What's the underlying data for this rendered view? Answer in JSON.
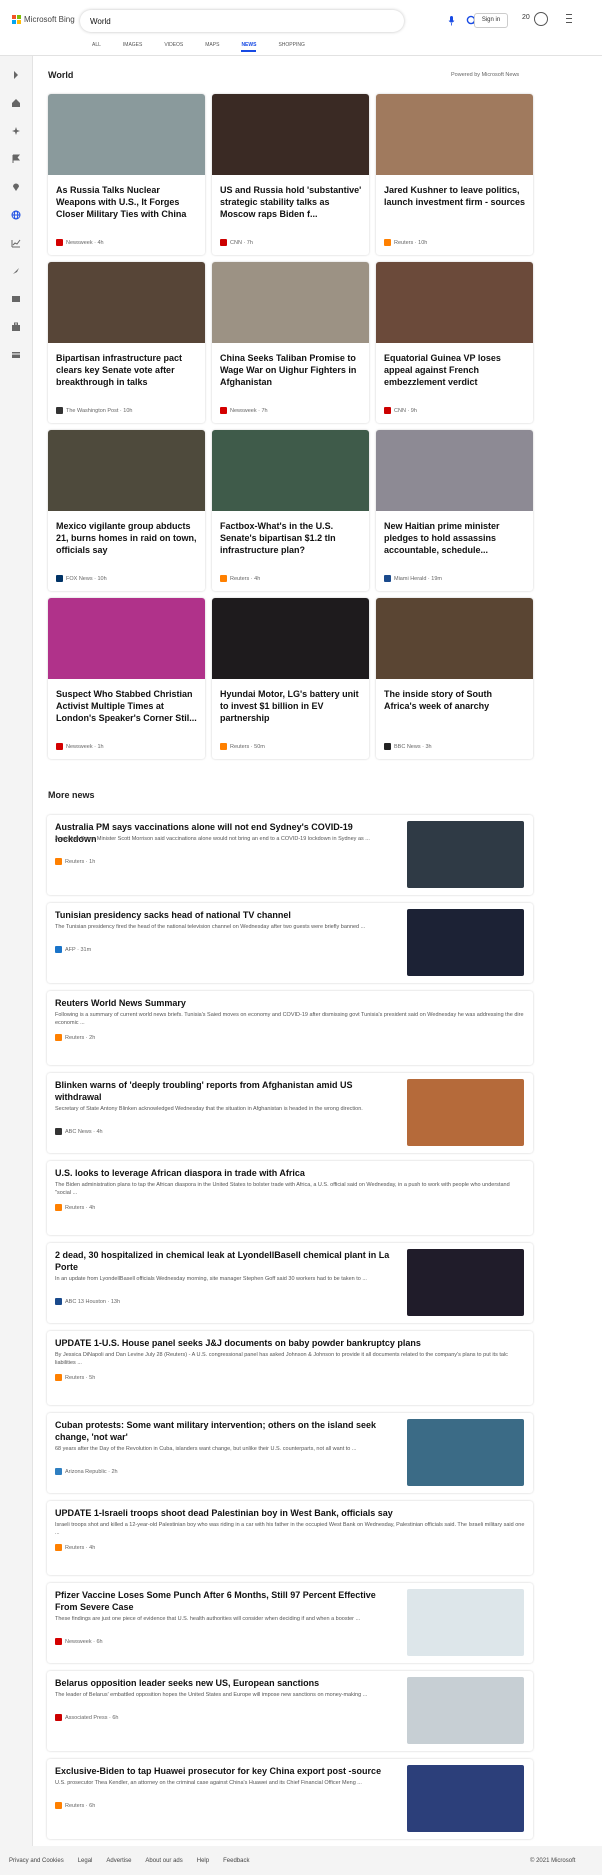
{
  "header": {
    "brand": "Microsoft Bing",
    "search_value": "World",
    "signin_label": "Sign in",
    "points": "20",
    "tabs": [
      {
        "label": "ALL"
      },
      {
        "label": "IMAGES"
      },
      {
        "label": "VIDEOS"
      },
      {
        "label": "MAPS"
      },
      {
        "label": "NEWS",
        "active": true
      },
      {
        "label": "SHOPPING"
      }
    ]
  },
  "colors": {
    "accent": "#174ae4",
    "ms_red": "#f35325",
    "ms_green": "#81bc06",
    "ms_blue": "#05a6f0",
    "ms_yellow": "#ffba08"
  },
  "section": {
    "title": "World",
    "powered": "Powered by Microsoft News"
  },
  "cards": [
    {
      "headline": "As Russia Talks Nuclear Weapons with U.S., It Forges Closer Military Ties with China",
      "source": "Newsweek · 4h",
      "img_color": "#8a9a9c",
      "logo": "#d40000"
    },
    {
      "headline": "US and Russia hold 'substantive' strategic stability talks as Moscow raps Biden f...",
      "source": "CNN · 7h",
      "img_color": "#3a2a24",
      "logo": "#cc0000"
    },
    {
      "headline": "Jared Kushner to leave politics, launch investment firm - sources",
      "source": "Reuters · 10h",
      "img_color": "#a07a5e",
      "logo": "#ff8000"
    },
    {
      "headline": "Bipartisan infrastructure pact clears key Senate vote after breakthrough in talks",
      "source": "The Washington Post · 10h",
      "img_color": "#574537",
      "logo": "#333333"
    },
    {
      "headline": "China Seeks Taliban Promise to Wage War on Uighur Fighters in Afghanistan",
      "source": "Newsweek · 7h",
      "img_color": "#9c9284",
      "logo": "#d40000"
    },
    {
      "headline": "Equatorial Guinea VP loses appeal against French embezzlement verdict",
      "source": "CNN · 9h",
      "img_color": "#6b4a3a",
      "logo": "#cc0000"
    },
    {
      "headline": "Mexico vigilante group abducts 21, burns homes in raid on town, officials say",
      "source": "FOX News · 10h",
      "img_color": "#4e4a3c",
      "logo": "#003366"
    },
    {
      "headline": "Factbox-What's in the U.S. Senate's bipartisan $1.2 tln infrastructure plan?",
      "source": "Reuters · 4h",
      "img_color": "#3f5b4a",
      "logo": "#ff8000"
    },
    {
      "headline": "New Haitian prime minister pledges to hold assassins accountable, schedule...",
      "source": "Miami Herald · 19m",
      "img_color": "#8d8a94",
      "logo": "#1a4a8c"
    },
    {
      "headline": "Suspect Who Stabbed Christian Activist Multiple Times at London's Speaker's Corner Stil...",
      "source": "Newsweek · 1h",
      "img_color": "#b0328a",
      "logo": "#d40000"
    },
    {
      "headline": "Hyundai Motor, LG's battery unit to invest $1 billion in EV partnership",
      "source": "Reuters · 50m",
      "img_color": "#1e1b1d",
      "logo": "#ff8000"
    },
    {
      "headline": "The inside story of South Africa's week of anarchy",
      "source": "BBC News · 3h",
      "img_color": "#5a4533",
      "logo": "#222222"
    }
  ],
  "more": {
    "title": "More news",
    "items": [
      {
        "headline": "Australia PM says vaccinations alone will not end Sydney's COVID-19 lockdown",
        "desc": "Australian Prime Minister Scott Morrison said vaccinations alone would not bring an end to a COVID-19 lockdown in Sydney as ...",
        "source": "Reuters · 1h",
        "thumb": "#2f3a45",
        "logo": "#ff8000"
      },
      {
        "headline": "Tunisian presidency sacks head of national TV channel",
        "desc": "The Tunisian presidency fired the head of the national television channel on Wednesday after two guests were briefly banned ...",
        "source": "AFP · 31m",
        "thumb": "#1c2235",
        "logo": "#1a74c9"
      },
      {
        "headline": "Reuters World News Summary",
        "desc": "Following is a summary of current world news briefs. Tunisia's Saied moves on economy and COVID-19 after dismissing govt Tunisia's president said on Wednesday he was addressing the dire economic ...",
        "source": "Reuters · 2h",
        "logo": "#ff8000"
      },
      {
        "headline": "Blinken warns of 'deeply troubling' reports from Afghanistan amid US withdrawal",
        "desc": "Secretary of State Antony Blinken acknowledged Wednesday that the situation in Afghanistan is headed in the wrong direction.",
        "source": "ABC News · 4h",
        "thumb": "#b56a3a",
        "logo": "#333333"
      },
      {
        "headline": "U.S. looks to leverage African diaspora in trade with Africa",
        "desc": "The Biden administration plans to tap the African diaspora in the United States to bolster trade with Africa, a U.S. official said on Wednesday, in a push to work with people who understand \"social ...",
        "source": "Reuters · 4h",
        "logo": "#ff8000"
      },
      {
        "headline": "2 dead, 30 hospitalized in chemical leak at LyondellBasell chemical plant in La Porte",
        "desc": "In an update from LyondellBasell officials Wednesday morning, site manager Stephen Goff said 30 workers had to be taken to ...",
        "source": "ABC 13 Houston · 13h",
        "thumb": "#201c2a",
        "logo": "#1a4a8c"
      },
      {
        "headline": "UPDATE 1-U.S. House panel seeks J&J documents on baby powder bankruptcy plans",
        "desc": "By Jessica DiNapoli and Dan Levine July 28 (Reuters) - A U.S. congressional panel has asked Johnson & Johnson to provide it all documents related to the company's plans to put its talc liabilities ...",
        "source": "Reuters · 5h",
        "logo": "#ff8000"
      },
      {
        "headline": "Cuban protests: Some want military intervention; others on the island seek change, 'not war'",
        "desc": "68 years after the Day of the Revolution in Cuba, islanders want change, but unlike their U.S. counterparts, not all want to ...",
        "source": "Arizona Republic · 2h",
        "thumb": "#3b6b86",
        "logo": "#2f7fc1"
      },
      {
        "headline": "UPDATE 1-Israeli troops shoot dead Palestinian boy in West Bank, officials say",
        "desc": "Israeli troops shot and killed a 12-year-old Palestinian boy who was riding in a car with his father in the occupied West Bank on Wednesday, Palestinian officials said. The Israeli military said one ...",
        "source": "Reuters · 4h",
        "logo": "#ff8000"
      },
      {
        "headline": "Pfizer Vaccine Loses Some Punch After 6 Months, Still 97 Percent Effective From Severe Case",
        "desc": "These findings are just one piece of evidence that U.S. health authorities will consider when deciding if and when a booster ...",
        "source": "Newsweek · 6h",
        "thumb": "#dde6ea",
        "logo": "#d40000"
      },
      {
        "headline": "Belarus opposition leader seeks new US, European sanctions",
        "desc": "The leader of Belarus' embattled opposition hopes the United States and Europe will impose new sanctions on money-making ...",
        "source": "Associated Press · 6h",
        "thumb": "#c7cfd4",
        "logo": "#cc0000"
      },
      {
        "headline": "Exclusive-Biden to tap Huawei prosecutor for key China export post -source",
        "desc": "U.S. prosecutor Thea Kendler, an attorney on the criminal case against China's Huawei and its Chief Financial Officer Meng ...",
        "source": "Reuters · 6h",
        "thumb": "#2c3f7a",
        "logo": "#ff8000"
      }
    ]
  },
  "footer": {
    "links": [
      "Privacy and Cookies",
      "Legal",
      "Advertise",
      "About our ads",
      "Help",
      "Feedback"
    ],
    "copyright": "© 2021 Microsoft"
  }
}
